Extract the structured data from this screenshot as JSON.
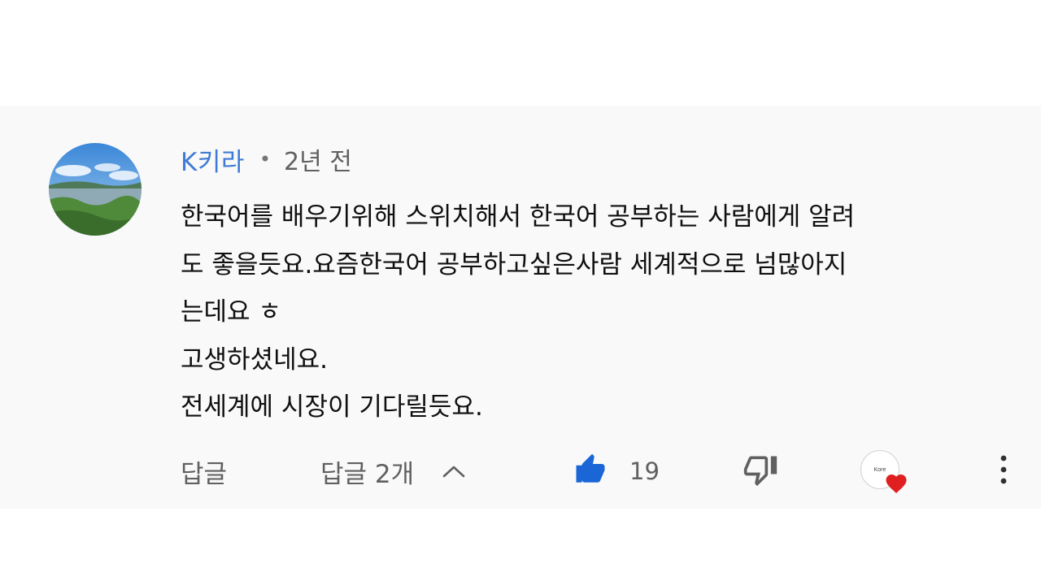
{
  "comment": {
    "author": "K키라",
    "separator": "•",
    "time": "2년 전",
    "lines": [
      "한국어를 배우기위해 스위치해서 한국어 공부하는 사람에게 알려",
      "도  좋을듯요.요즘한국어 공부하고싶은사람 세계적으로 넘많아지",
      "는데요 ㅎ",
      "고생하셨네요.",
      "전세계에 시장이 기다릴듯요."
    ]
  },
  "actions": {
    "reply_label": "답글",
    "replies_label": "답글 2개",
    "like_count": "19",
    "creator_avatar_text": "Kore",
    "icons": {
      "chevron": "chevron-up-icon",
      "like": "thumbs-up-icon",
      "dislike": "thumbs-down-icon",
      "heart": "heart-icon",
      "more": "more-vert-icon"
    }
  },
  "colors": {
    "author": "#3e7bd6",
    "like_active": "#1a66d6",
    "heart": "#e02020",
    "card_bg": "#f9f9f9"
  }
}
